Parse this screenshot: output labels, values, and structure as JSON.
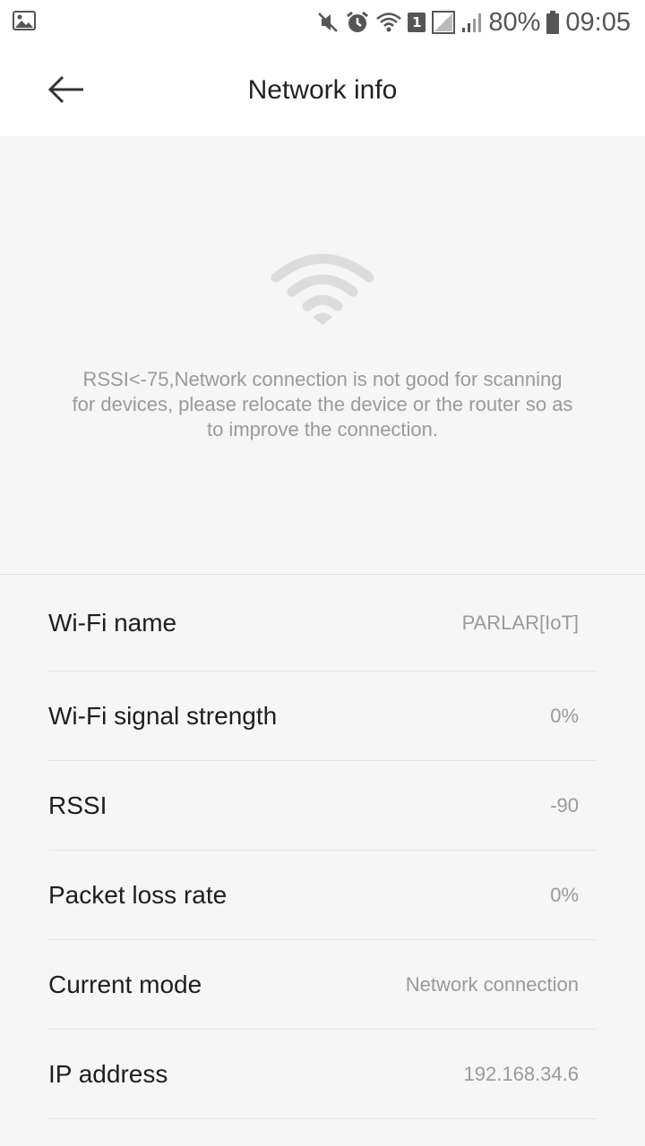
{
  "status_bar": {
    "battery": "80%",
    "time": "09:05",
    "sim_slot": "1",
    "icons": [
      "image-icon",
      "mute-icon",
      "alarm-icon",
      "wifi-icon",
      "sim-icon",
      "no-signal-icon",
      "signal-icon",
      "battery-icon"
    ]
  },
  "header": {
    "title": "Network info",
    "back_icon": "arrow-left-icon"
  },
  "hero": {
    "icon": "wifi-icon",
    "message": "RSSI<-75,Network connection is not good for scanning for devices, please relocate the device or the router so as to improve the connection."
  },
  "info_rows": [
    {
      "label": "Wi-Fi name",
      "value": "PARLAR[IoT]"
    },
    {
      "label": "Wi-Fi signal strength",
      "value": "0%"
    },
    {
      "label": "RSSI",
      "value": "-90"
    },
    {
      "label": "Packet loss rate",
      "value": "0%"
    },
    {
      "label": "Current mode",
      "value": "Network connection"
    },
    {
      "label": "IP address",
      "value": "192.168.34.6"
    }
  ],
  "colors": {
    "background": "#f6f6f6",
    "header_bg": "#ffffff",
    "hero_icon": "#dcdcdc",
    "muted_text": "#9a9a9a",
    "primary_text": "#1e1e1e"
  }
}
